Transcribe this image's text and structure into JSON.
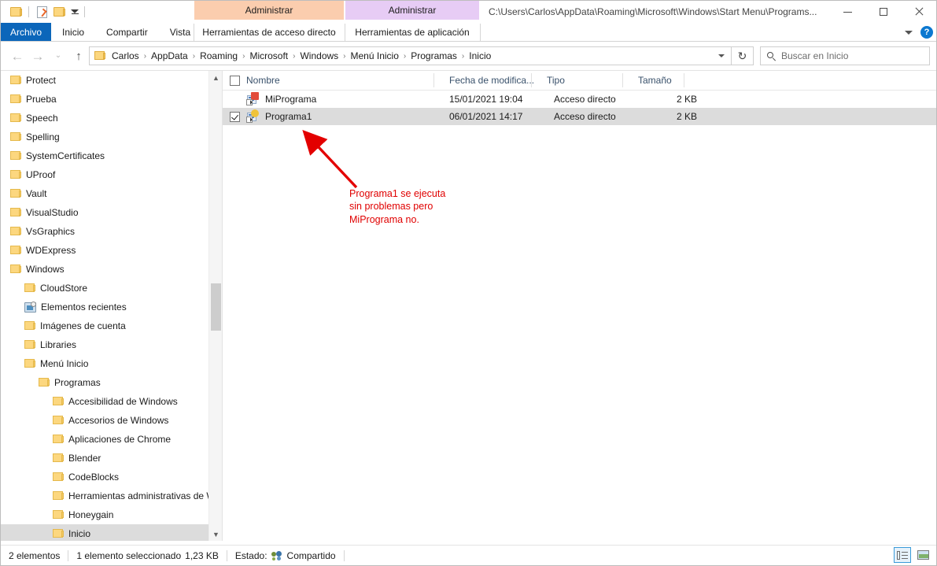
{
  "window": {
    "title": "C:\\Users\\Carlos\\AppData\\Roaming\\Microsoft\\Windows\\Start Menu\\Programs...",
    "minimize_label": "Minimizar",
    "maximize_label": "Maximizar",
    "close_label": "Cerrar"
  },
  "quick_access": {
    "folder_label": "Propiedades de carpeta",
    "properties_label": "Propiedades",
    "new_folder_label": "Nueva carpeta",
    "dropdown_label": "Personalizar barra de herramientas de acceso rapido"
  },
  "ribbon": {
    "tabs": [
      {
        "label": "Archivo",
        "active_file": true
      },
      {
        "label": "Inicio"
      },
      {
        "label": "Compartir"
      },
      {
        "label": "Vista"
      }
    ],
    "contextual": [
      {
        "group": "Administrar",
        "tab": "Herramientas de acceso directo",
        "color": "#fbcdae"
      },
      {
        "group": "Administrar",
        "tab": "Herramientas de aplicación",
        "color": "#e7ccf5"
      }
    ],
    "collapse_label": "Contraer la cinta de opciones",
    "help_label": "?"
  },
  "address": {
    "back_label": "Atrás",
    "forward_label": "Adelante",
    "recent_label": "Ubicaciones recientes",
    "up_label": "Subir un nivel",
    "crumbs": [
      "Carlos",
      "AppData",
      "Roaming",
      "Microsoft",
      "Windows",
      "Menú Inicio",
      "Programas",
      "Inicio"
    ],
    "refresh_label": "Actualizar"
  },
  "search": {
    "placeholder": "Buscar en Inicio"
  },
  "nav_tree": {
    "items": [
      {
        "label": "Protect",
        "indent": 0,
        "icon": "folder-icon",
        "selected": false
      },
      {
        "label": "Prueba",
        "indent": 0,
        "icon": "folder-icon",
        "selected": false
      },
      {
        "label": "Speech",
        "indent": 0,
        "icon": "folder-icon",
        "selected": false
      },
      {
        "label": "Spelling",
        "indent": 0,
        "icon": "folder-icon",
        "selected": false
      },
      {
        "label": "SystemCertificates",
        "indent": 0,
        "icon": "folder-icon",
        "selected": false
      },
      {
        "label": "UProof",
        "indent": 0,
        "icon": "folder-icon",
        "selected": false
      },
      {
        "label": "Vault",
        "indent": 0,
        "icon": "folder-icon",
        "selected": false
      },
      {
        "label": "VisualStudio",
        "indent": 0,
        "icon": "folder-icon",
        "selected": false
      },
      {
        "label": "VsGraphics",
        "indent": 0,
        "icon": "folder-icon",
        "selected": false
      },
      {
        "label": "WDExpress",
        "indent": 0,
        "icon": "folder-icon",
        "selected": false
      },
      {
        "label": "Windows",
        "indent": 0,
        "icon": "folder-icon",
        "selected": false
      },
      {
        "label": "CloudStore",
        "indent": 1,
        "icon": "folder-icon",
        "selected": false
      },
      {
        "label": "Elementos recientes",
        "indent": 1,
        "icon": "recent-items-icon",
        "selected": false
      },
      {
        "label": "Imágenes de cuenta",
        "indent": 1,
        "icon": "folder-icon",
        "selected": false
      },
      {
        "label": "Libraries",
        "indent": 1,
        "icon": "folder-icon",
        "selected": false
      },
      {
        "label": "Menú Inicio",
        "indent": 1,
        "icon": "folder-icon",
        "selected": false
      },
      {
        "label": "Programas",
        "indent": 2,
        "icon": "folder-icon",
        "selected": false
      },
      {
        "label": "Accesibilidad de Windows",
        "indent": 3,
        "icon": "folder-icon",
        "selected": false
      },
      {
        "label": "Accesorios de Windows",
        "indent": 3,
        "icon": "folder-icon",
        "selected": false
      },
      {
        "label": "Aplicaciones de Chrome",
        "indent": 3,
        "icon": "folder-icon",
        "selected": false
      },
      {
        "label": "Blender",
        "indent": 3,
        "icon": "folder-icon",
        "selected": false
      },
      {
        "label": "CodeBlocks",
        "indent": 3,
        "icon": "folder-icon",
        "selected": false
      },
      {
        "label": "Herramientas administrativas de W",
        "indent": 3,
        "icon": "folder-icon",
        "selected": false
      },
      {
        "label": "Honeygain",
        "indent": 3,
        "icon": "folder-icon",
        "selected": false
      },
      {
        "label": "Inicio",
        "indent": 3,
        "icon": "folder-icon",
        "selected": true
      }
    ],
    "scroll_up_label": "▲",
    "scroll_down_label": "▼"
  },
  "file_list": {
    "columns": [
      {
        "label": "Nombre",
        "sort": "asc"
      },
      {
        "label": "Fecha de modifica..."
      },
      {
        "label": "Tipo"
      },
      {
        "label": "Tamaño"
      }
    ],
    "select_all_label": "Seleccionar todo",
    "rows": [
      {
        "name": "MiPrograma",
        "date": "15/01/2021 19:04",
        "type": "Acceso directo",
        "size": "2 KB",
        "checked": false,
        "selected": false,
        "icon": "shortcut-icon"
      },
      {
        "name": "Programa1",
        "date": "06/01/2021 14:17",
        "type": "Acceso directo",
        "size": "2 KB",
        "checked": true,
        "selected": true,
        "icon": "shortcut-icon"
      }
    ]
  },
  "annotation": {
    "line1": "Programa1 se ejecuta",
    "line2": "sin problemas pero",
    "line3": "MiPrograma no.",
    "color": "#e00000",
    "arrow_label": "red-arrow"
  },
  "status_bar": {
    "items_count": "2 elementos",
    "selection": "1 elemento seleccionado",
    "selection_size": "1,23 KB",
    "state_label": "Estado:",
    "state_value": "Compartido",
    "view_details_label": "Detalles",
    "view_large_label": "Iconos grandes"
  }
}
